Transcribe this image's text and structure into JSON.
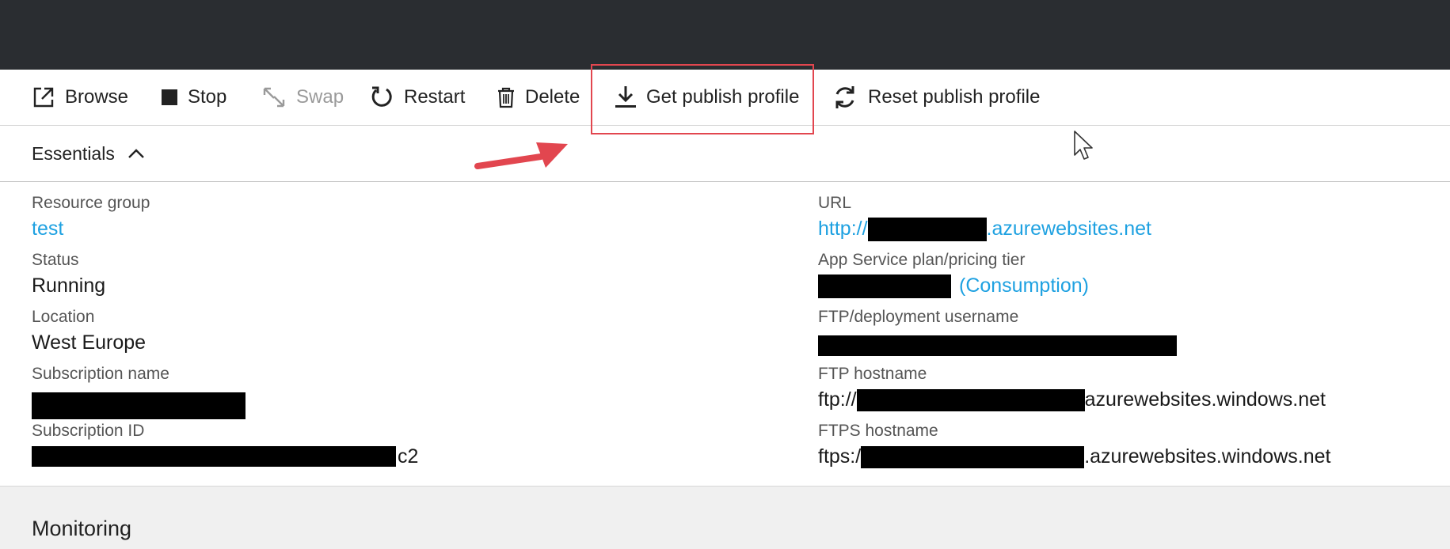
{
  "toolbar": {
    "browse": "Browse",
    "stop": "Stop",
    "swap": "Swap",
    "restart": "Restart",
    "delete": "Delete",
    "get_publish_profile": "Get publish profile",
    "reset_publish_profile": "Reset publish profile"
  },
  "essentials": {
    "title": "Essentials",
    "left": {
      "resource_group_label": "Resource group",
      "resource_group_value": "test",
      "status_label": "Status",
      "status_value": "Running",
      "location_label": "Location",
      "location_value": "West Europe",
      "subscription_name_label": "Subscription name",
      "subscription_id_label": "Subscription ID",
      "subscription_id_suffix": "c2"
    },
    "right": {
      "url_label": "URL",
      "url_prefix": "http://",
      "url_suffix": ".azurewebsites.net",
      "plan_label": "App Service plan/pricing tier",
      "plan_suffix": "(Consumption)",
      "ftp_user_label": "FTP/deployment username",
      "ftp_host_label": "FTP hostname",
      "ftp_host_prefix": "ftp://",
      "ftp_host_suffix": "azurewebsites.windows.net",
      "ftps_host_label": "FTPS hostname",
      "ftps_host_prefix": "ftps:/",
      "ftps_host_suffix": ".azurewebsites.windows.net"
    }
  },
  "monitoring": {
    "title": "Monitoring"
  },
  "colors": {
    "topbar": "#2a2d31",
    "link": "#1ea1e1",
    "highlight": "#e2464f",
    "arrow": "#e2464f"
  }
}
